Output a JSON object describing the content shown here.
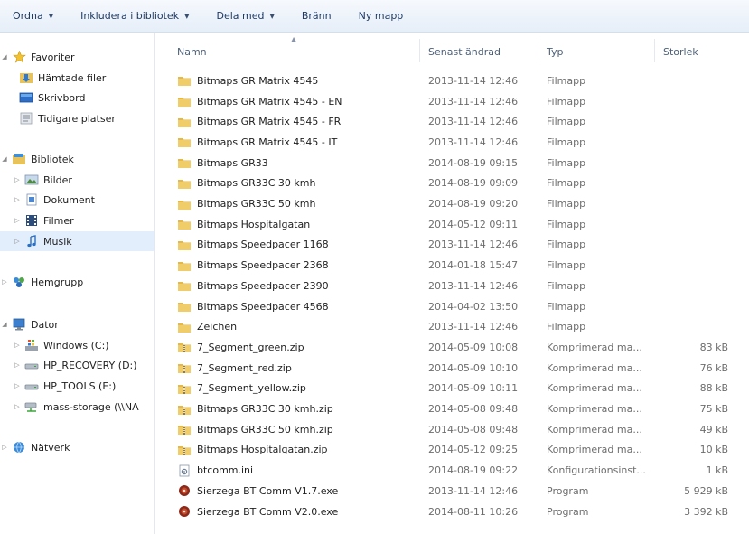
{
  "toolbar": {
    "organize": "Ordna",
    "include": "Inkludera i bibliotek",
    "share": "Dela med",
    "burn": "Bränn",
    "new_folder": "Ny mapp"
  },
  "nav": {
    "favorites": "Favoriter",
    "downloads": "Hämtade filer",
    "desktop": "Skrivbord",
    "recent": "Tidigare platser",
    "libraries": "Bibliotek",
    "pictures": "Bilder",
    "documents": "Dokument",
    "videos": "Filmer",
    "music": "Musik",
    "homegroup": "Hemgrupp",
    "computer": "Dator",
    "drive_c": "Windows (C:)",
    "drive_d": "HP_RECOVERY (D:)",
    "drive_e": "HP_TOOLS (E:)",
    "network_drive": "mass-storage (\\\\NA",
    "network": "Nätverk"
  },
  "columns": {
    "name": "Namn",
    "date": "Senast ändrad",
    "type": "Typ",
    "size": "Storlek"
  },
  "files": [
    {
      "name": "Bitmaps GR Matrix 4545",
      "date": "2013-11-14 12:46",
      "type": "Filmapp",
      "size": "",
      "icon": "folder-icon"
    },
    {
      "name": "Bitmaps GR Matrix 4545 - EN",
      "date": "2013-11-14 12:46",
      "type": "Filmapp",
      "size": "",
      "icon": "folder-icon"
    },
    {
      "name": "Bitmaps GR Matrix 4545 - FR",
      "date": "2013-11-14 12:46",
      "type": "Filmapp",
      "size": "",
      "icon": "folder-icon"
    },
    {
      "name": "Bitmaps GR Matrix 4545 - IT",
      "date": "2013-11-14 12:46",
      "type": "Filmapp",
      "size": "",
      "icon": "folder-icon"
    },
    {
      "name": "Bitmaps GR33",
      "date": "2014-08-19 09:15",
      "type": "Filmapp",
      "size": "",
      "icon": "folder-icon"
    },
    {
      "name": "Bitmaps GR33C 30 kmh",
      "date": "2014-08-19 09:09",
      "type": "Filmapp",
      "size": "",
      "icon": "folder-icon"
    },
    {
      "name": "Bitmaps GR33C 50 kmh",
      "date": "2014-08-19 09:20",
      "type": "Filmapp",
      "size": "",
      "icon": "folder-icon"
    },
    {
      "name": "Bitmaps Hospitalgatan",
      "date": "2014-05-12 09:11",
      "type": "Filmapp",
      "size": "",
      "icon": "folder-icon"
    },
    {
      "name": "Bitmaps Speedpacer 1168",
      "date": "2013-11-14 12:46",
      "type": "Filmapp",
      "size": "",
      "icon": "folder-icon"
    },
    {
      "name": "Bitmaps Speedpacer 2368",
      "date": "2014-01-18 15:47",
      "type": "Filmapp",
      "size": "",
      "icon": "folder-icon"
    },
    {
      "name": "Bitmaps Speedpacer 2390",
      "date": "2013-11-14 12:46",
      "type": "Filmapp",
      "size": "",
      "icon": "folder-icon"
    },
    {
      "name": "Bitmaps Speedpacer 4568",
      "date": "2014-04-02 13:50",
      "type": "Filmapp",
      "size": "",
      "icon": "folder-icon"
    },
    {
      "name": "Zeichen",
      "date": "2013-11-14 12:46",
      "type": "Filmapp",
      "size": "",
      "icon": "folder-icon"
    },
    {
      "name": "7_Segment_green.zip",
      "date": "2014-05-09 10:08",
      "type": "Komprimerad ma...",
      "size": "83 kB",
      "icon": "zip-folder-icon"
    },
    {
      "name": "7_Segment_red.zip",
      "date": "2014-05-09 10:10",
      "type": "Komprimerad ma...",
      "size": "76 kB",
      "icon": "zip-folder-icon"
    },
    {
      "name": "7_Segment_yellow.zip",
      "date": "2014-05-09 10:11",
      "type": "Komprimerad ma...",
      "size": "88 kB",
      "icon": "zip-folder-icon"
    },
    {
      "name": "Bitmaps GR33C 30 kmh.zip",
      "date": "2014-05-08 09:48",
      "type": "Komprimerad ma...",
      "size": "75 kB",
      "icon": "zip-folder-icon"
    },
    {
      "name": "Bitmaps GR33C 50 kmh.zip",
      "date": "2014-05-08 09:48",
      "type": "Komprimerad ma...",
      "size": "49 kB",
      "icon": "zip-folder-icon"
    },
    {
      "name": "Bitmaps Hospitalgatan.zip",
      "date": "2014-05-12 09:25",
      "type": "Komprimerad ma...",
      "size": "10 kB",
      "icon": "zip-folder-icon"
    },
    {
      "name": "btcomm.ini",
      "date": "2014-08-19 09:22",
      "type": "Konfigurationsinst...",
      "size": "1 kB",
      "icon": "config-file-icon"
    },
    {
      "name": "Sierzega BT Comm V1.7.exe",
      "date": "2013-11-14 12:46",
      "type": "Program",
      "size": "5 929 kB",
      "icon": "program-icon"
    },
    {
      "name": "Sierzega BT Comm V2.0.exe",
      "date": "2014-08-11 10:26",
      "type": "Program",
      "size": "3 392 kB",
      "icon": "program-icon"
    }
  ],
  "colors": {
    "folder": "#e8c25a",
    "selection": "#e3eefc",
    "toolbar_text": "#1f3a66"
  }
}
